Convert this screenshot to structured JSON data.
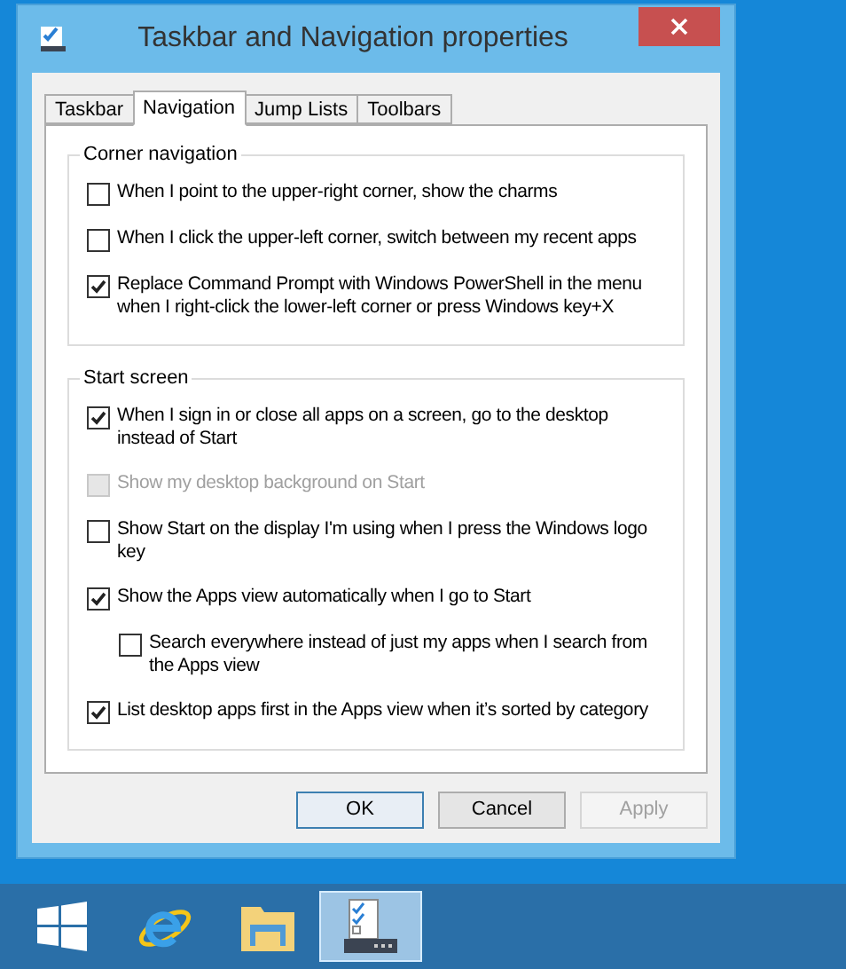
{
  "window": {
    "title": "Taskbar and Navigation properties"
  },
  "tabs": [
    {
      "label": "Taskbar",
      "selected": false
    },
    {
      "label": "Navigation",
      "selected": true
    },
    {
      "label": "Jump Lists",
      "selected": false
    },
    {
      "label": "Toolbars",
      "selected": false
    }
  ],
  "groups": [
    {
      "title": "Corner navigation",
      "options": [
        {
          "label": "When I point to the upper-right corner, show the charms",
          "checked": false,
          "disabled": false
        },
        {
          "label": "When I click the upper-left corner, switch between my recent apps",
          "checked": false,
          "disabled": false
        },
        {
          "label": "Replace Command Prompt with Windows PowerShell in the menu when I right-click the lower-left corner or press Windows key+X",
          "checked": true,
          "disabled": false
        }
      ]
    },
    {
      "title": "Start screen",
      "options": [
        {
          "label": "When I sign in or close all apps on a screen, go to the desktop instead of Start",
          "checked": true,
          "disabled": false
        },
        {
          "label": "Show my desktop background on Start",
          "checked": false,
          "disabled": true
        },
        {
          "label": "Show Start on the display I'm using when I press the Windows logo key",
          "checked": false,
          "disabled": false
        },
        {
          "label": "Show the Apps view automatically when I go to Start",
          "checked": true,
          "disabled": false,
          "children": [
            {
              "label": "Search everywhere instead of just my apps when I search from the Apps view",
              "checked": false,
              "disabled": false
            }
          ]
        },
        {
          "label": "List desktop apps first in the Apps view when it’s sorted by category",
          "checked": true,
          "disabled": false
        }
      ]
    }
  ],
  "buttons": [
    {
      "label": "OK",
      "disabled": false,
      "default": true
    },
    {
      "label": "Cancel",
      "disabled": false,
      "default": false
    },
    {
      "label": "Apply",
      "disabled": true,
      "default": false
    }
  ],
  "taskbar": {
    "items": [
      {
        "kind": "start",
        "selected": false
      },
      {
        "kind": "browser",
        "selected": false
      },
      {
        "kind": "folder",
        "selected": false
      },
      {
        "kind": "settings",
        "selected": true
      }
    ]
  }
}
